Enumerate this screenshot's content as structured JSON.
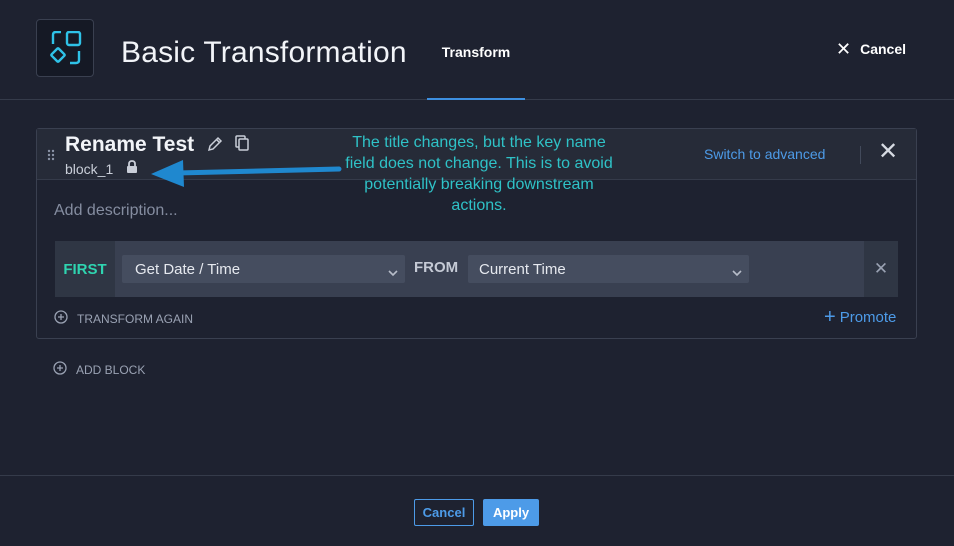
{
  "header": {
    "title": "Basic Transformation",
    "tab_label": "Transform",
    "cancel_label": "Cancel"
  },
  "block": {
    "title": "Rename Test",
    "key_name": "block_1",
    "switch_label": "Switch to advanced",
    "description_placeholder": "Add description...",
    "step": {
      "position_label": "FIRST",
      "transform_selected": "Get Date / Time",
      "from_label": "FROM",
      "source_selected": "Current Time"
    },
    "transform_again_label": "TRANSFORM AGAIN",
    "promote_label": "Promote"
  },
  "add_block_label": "ADD BLOCK",
  "annotation": {
    "text": "The title changes, but the key name field does not change. This is to avoid potentially breaking downstream actions."
  },
  "footer": {
    "cancel_label": "Cancel",
    "apply_label": "Apply"
  },
  "colors": {
    "background": "#1e2230",
    "accent": "#4d9be8",
    "teal": "#2fd4b0",
    "annotation": "#2fc2c7"
  },
  "icons": {
    "logo": "transform-logo-icon",
    "pencil": "pencil-icon",
    "copy": "copy-icon",
    "lock": "lock-icon",
    "drag": "drag-handle-icon",
    "close": "close-icon",
    "chevron": "chevron-down-icon",
    "add_circle": "plus-circle-icon"
  }
}
